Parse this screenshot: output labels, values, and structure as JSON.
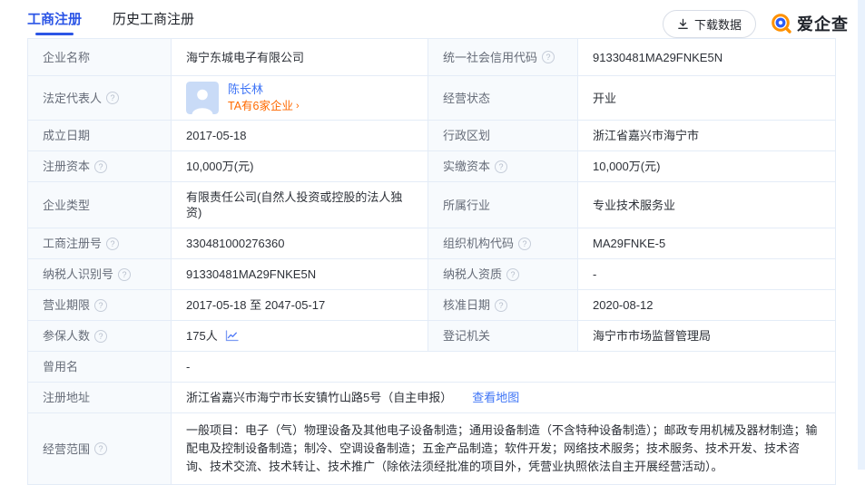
{
  "page": {
    "tabs": [
      {
        "label": "工商注册"
      },
      {
        "label": "历史工商注册"
      }
    ],
    "download_button": "下载数据",
    "brand": "爱企查"
  },
  "icons": {
    "help": "?",
    "chevron": "›"
  },
  "colors": {
    "tab_active": "#2b55e6",
    "link_blue": "#3e74f6",
    "link_orange": "#ff6a00",
    "logo_orange": "#ff9100",
    "logo_blue": "#2d5cf6"
  },
  "registration": {
    "company_name": {
      "label": "企业名称",
      "value": "海宁东城电子有限公司"
    },
    "credit_code": {
      "label": "统一社会信用代码",
      "value": "91330481MA29FNKE5N"
    },
    "legal_rep": {
      "label": "法定代表人",
      "name": "陈长林",
      "related": "TA有6家企业"
    },
    "status": {
      "label": "经营状态",
      "value": "开业"
    },
    "establish_date": {
      "label": "成立日期",
      "value": "2017-05-18"
    },
    "admin_division": {
      "label": "行政区划",
      "value": "浙江省嘉兴市海宁市"
    },
    "registered_capital": {
      "label": "注册资本",
      "value": "10,000万(元)"
    },
    "paid_capital": {
      "label": "实缴资本",
      "value": "10,000万(元)"
    },
    "company_type": {
      "label": "企业类型",
      "value": "有限责任公司(自然人投资或控股的法人独资)"
    },
    "industry": {
      "label": "所属行业",
      "value": "专业技术服务业"
    },
    "reg_number": {
      "label": "工商注册号",
      "value": "330481000276360"
    },
    "org_code": {
      "label": "组织机构代码",
      "value": "MA29FNKE-5"
    },
    "taxpayer_id": {
      "label": "纳税人识别号",
      "value": "91330481MA29FNKE5N"
    },
    "taxpayer_qualification": {
      "label": "纳税人资质",
      "value": "-"
    },
    "business_term": {
      "label": "营业期限",
      "value": "2017-05-18 至 2047-05-17"
    },
    "approval_date": {
      "label": "核准日期",
      "value": "2020-08-12"
    },
    "insured_count": {
      "label": "参保人数",
      "value": "175人"
    },
    "registration_authority": {
      "label": "登记机关",
      "value": "海宁市市场监督管理局"
    },
    "former_name": {
      "label": "曾用名",
      "value": "-"
    },
    "registered_address": {
      "label": "注册地址",
      "value": "浙江省嘉兴市海宁市长安镇竹山路5号（自主申报）",
      "map_link": "查看地图"
    },
    "business_scope": {
      "label": "经营范围",
      "value": "一般项目：电子（气）物理设备及其他电子设备制造；通用设备制造（不含特种设备制造）；邮政专用机械及器材制造；输配电及控制设备制造；制冷、空调设备制造；五金产品制造；软件开发；网络技术服务；技术服务、技术开发、技术咨询、技术交流、技术转让、技术推广（除依法须经批准的项目外，凭营业执照依法自主开展经营活动）。"
    }
  }
}
